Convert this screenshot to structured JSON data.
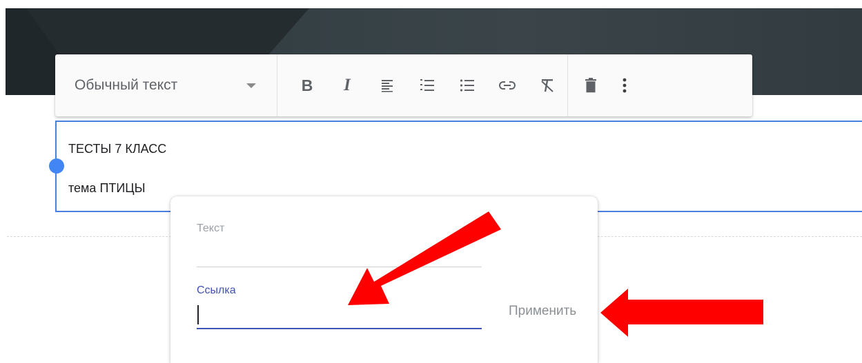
{
  "toolbar": {
    "style_select": {
      "value": "Обычный текст"
    },
    "bold_label": "B",
    "italic_label": "I"
  },
  "editor": {
    "line1": "ТЕСТЫ 7 КЛАСС",
    "line2": "тема ПТИЦЫ"
  },
  "link_dialog": {
    "text_label": "Текст",
    "link_label": "Ссылка",
    "link_value": "",
    "apply_label": "Применить"
  },
  "colors": {
    "accent": "#3f51b5",
    "selection_border": "#4a7fe0",
    "annotation_arrow": "#ff0000"
  },
  "icons": [
    "caret-down-icon",
    "align-left-icon",
    "numbered-list-icon",
    "bulleted-list-icon",
    "link-icon",
    "clear-format-icon",
    "delete-icon",
    "more-vert-icon",
    "arrow-annotation"
  ]
}
